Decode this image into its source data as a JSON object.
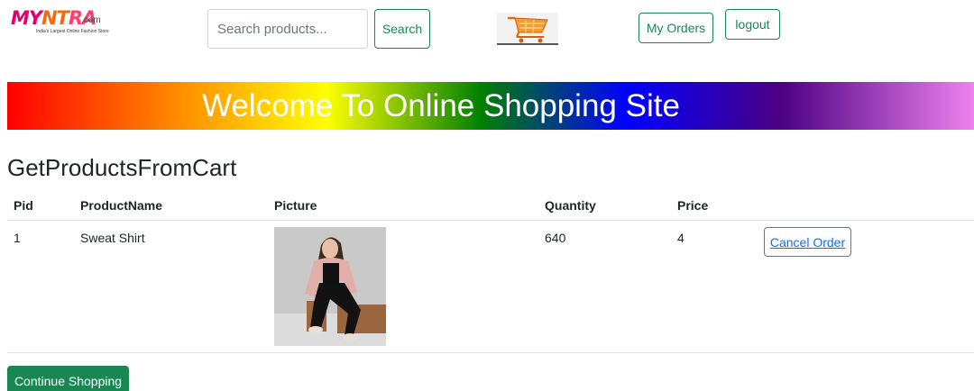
{
  "header": {
    "logo": {
      "part1": "MY",
      "part2": "NT",
      "part3": "RA",
      "suffix": ".com",
      "tagline": "India's Largest Online Fashion Store"
    },
    "search": {
      "placeholder": "Search products...",
      "button_label": "Search"
    },
    "cart_icon": "shopping-cart-icon",
    "my_orders_label": "My Orders",
    "logout_label": "logout"
  },
  "banner": {
    "text": "Welcome To Online Shopping Site"
  },
  "page_title": "GetProductsFromCart",
  "table": {
    "columns": [
      "Pid",
      "ProductName",
      "Picture",
      "Quantity",
      "Price"
    ],
    "rows": [
      {
        "pid": "1",
        "product_name": "Sweat Shirt",
        "picture": "product-photo",
        "quantity": "640",
        "price": "4",
        "action_label": "Cancel Order"
      }
    ]
  },
  "continue_label": "Continue Shopping",
  "colors": {
    "accent_green": "#198754",
    "link_blue": "#0d6efd"
  }
}
